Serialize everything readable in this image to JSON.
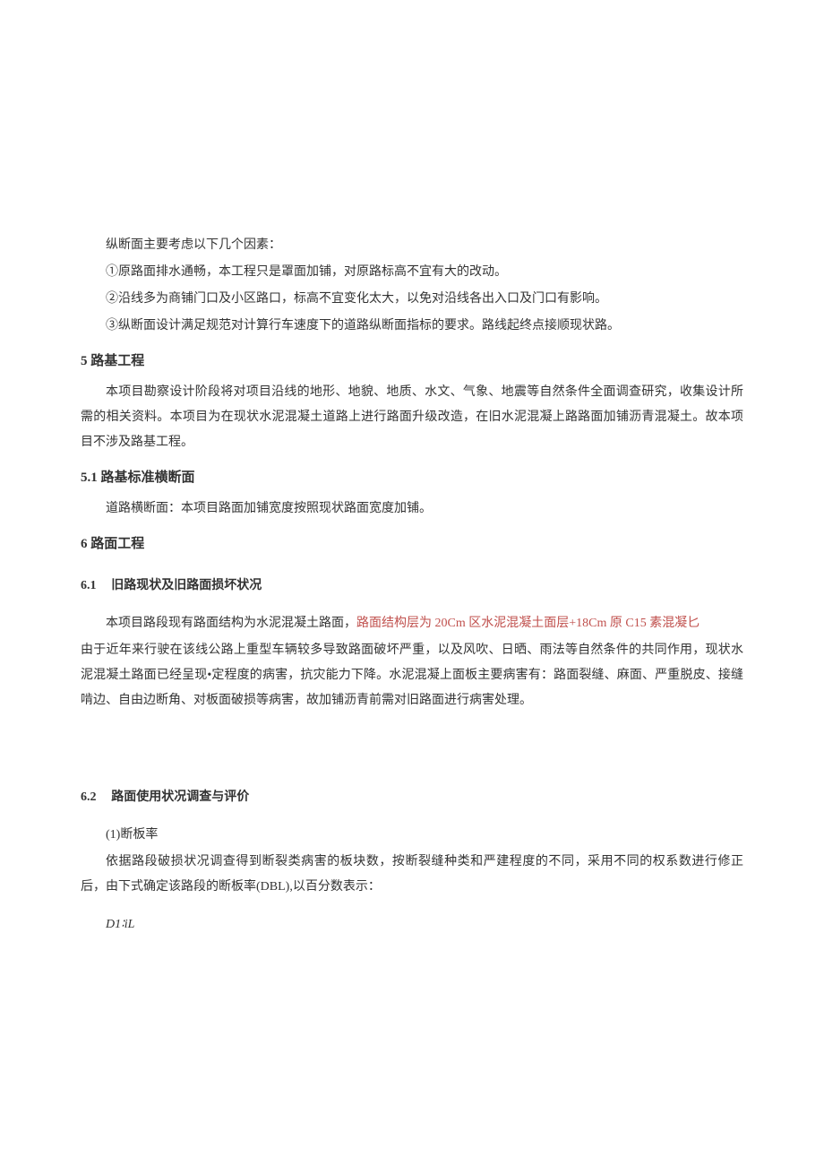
{
  "intro": {
    "lead": "纵断面主要考虑以下几个因素：",
    "item1": "①原路面排水通畅，本工程只是罩面加铺，对原路标高不宜有大的改动。",
    "item2": "②沿线多为商铺门口及小区路口，标高不宜变化太大，以免对沿线各出入口及门口有影响。",
    "item3": "③纵断面设计满足规范对计算行车速度下的道路纵断面指标的要求。路线起终点接顺现状路。"
  },
  "section5": {
    "title": "5 路基工程",
    "para1": "本项目勘察设计阶段将对项目沿线的地形、地貌、地质、水文、气象、地震等自然条件全面调查研究，收集设计所需的相关资料。本项目为在现状水泥混凝土道路上进行路面升级改造，在旧水泥混凝上路路面加铺沥青混凝土。故本项目不涉及路基工程。"
  },
  "section5_1": {
    "title": "5.1 路基标准横断面",
    "para1": "道路横断面：本项目路面加铺宽度按照现状路面宽度加铺。"
  },
  "section6": {
    "title": "6 路面工程"
  },
  "section6_1": {
    "num": "6.1",
    "title": "旧路现状及旧路面损坏状况",
    "para1_prefix": "本项目路段现有路面结构为水泥混凝土路面，",
    "para1_highlight": "路面结构层为 20Cm 区水泥混凝土面层+18Cm 原 C15 素混凝匕",
    "para2": "由于近年来行驶在该线公路上重型车辆较多导致路面破坏严重，以及风吹、日晒、雨法等自然条件的共同作用，现状水泥混凝土路面已经呈现•定程度的病害，抗灾能力下降。水泥混凝上面板主要病害有：路面裂缝、麻面、严重脱皮、接缝啃边、自由边断角、对板面破损等病害，故加铺沥青前需对旧路面进行病害处理。"
  },
  "section6_2": {
    "num": "6.2",
    "title": "路面使用状况调查与评价",
    "item1_label": "(1)断板率",
    "para1": "依据路段破损状况调查得到断裂类病害的板块数，按断裂缝种类和严建程度的不同，采用不同的权系数进行修正后，由下式确定该路段的断板率(DBL),以百分数表示：",
    "formula": "D1∶iL"
  }
}
